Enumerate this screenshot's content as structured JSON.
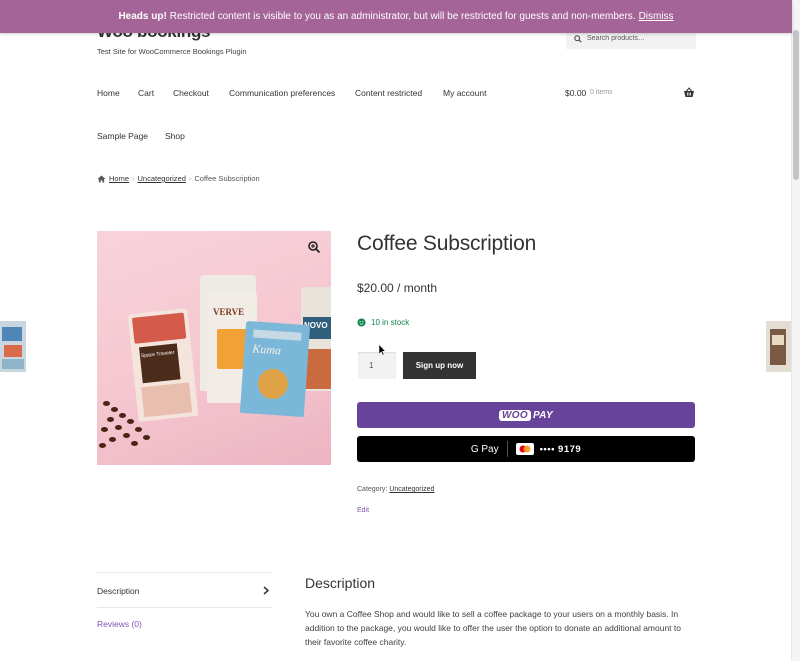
{
  "notice": {
    "heading": "Heads up!",
    "message": "Restricted content is visible to you as an administrator, but will be restricted for guests and non-members.",
    "dismiss_label": "Dismiss"
  },
  "site": {
    "title": "Woo bookings",
    "tagline": "Test Site for WooCommerce Bookings Plugin"
  },
  "search": {
    "placeholder": "Search products…"
  },
  "nav": {
    "items": [
      "Home",
      "Cart",
      "Checkout",
      "Communication preferences",
      "Content restricted",
      "My account",
      "Sample Page",
      "Shop"
    ]
  },
  "cart": {
    "total": "$0.00",
    "count": "0 items"
  },
  "breadcrumb": {
    "home": "Home",
    "category": "Uncategorized",
    "current": "Coffee Subscription",
    "separator": "›"
  },
  "product": {
    "title": "Coffee Subscription",
    "price": "$20.00 / month",
    "stock": "10 in stock",
    "quantity": "1",
    "signup_label": "Sign up now",
    "woopay": {
      "woo": "WOO",
      "pay": "PAY"
    },
    "gpay": {
      "label": "G Pay",
      "card_last4": "•••• 9179"
    },
    "category_label": "Category:",
    "category": "Uncategorized",
    "edit_label": "Edit",
    "image_texts": {
      "verve": "VERVE",
      "novo": "NOVO",
      "kuma": "Kuma",
      "spacetraveler": "Space Traveler"
    }
  },
  "tabs": {
    "description": "Description",
    "reviews": "Reviews (0)"
  },
  "description": {
    "heading": "Description",
    "text": "You own a Coffee Shop and would like to sell a coffee package to your users on a monthly basis. In addition to the package, you would like to offer the user the option to donate an additional amount to their favorite coffee charity."
  },
  "colors": {
    "notice_bg": "#a46497",
    "woopay_bg": "#674399",
    "stock_green": "#0f834d",
    "link_purple": "#7f54b3"
  }
}
